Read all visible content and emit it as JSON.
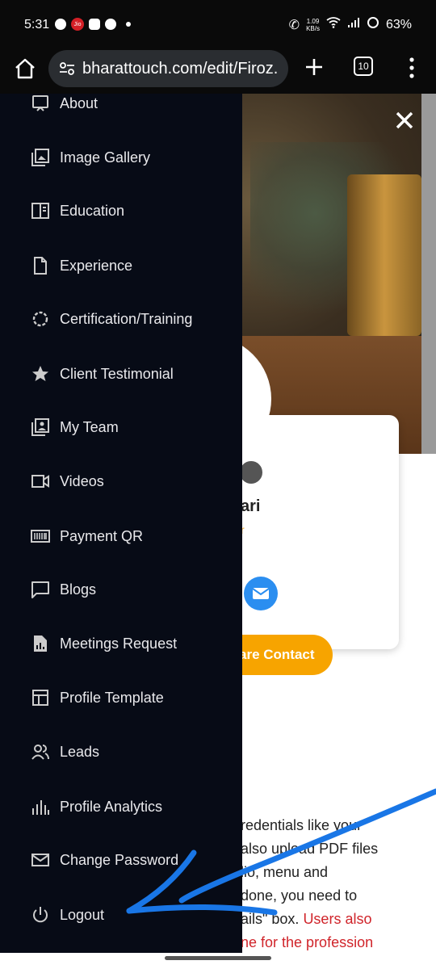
{
  "status_bar": {
    "time": "5:31",
    "jio": "Jio",
    "speed_value": "1.09",
    "speed_unit": "KB/s",
    "battery": "63%"
  },
  "browser": {
    "url": "bharattouch.com/edit/Firoz.",
    "tab_count": "10"
  },
  "drawer": {
    "items": [
      {
        "label": "About",
        "icon": "about-icon"
      },
      {
        "label": "Image Gallery",
        "icon": "image-gallery-icon"
      },
      {
        "label": "Education",
        "icon": "education-icon"
      },
      {
        "label": "Experience",
        "icon": "experience-icon"
      },
      {
        "label": "Certification/Training",
        "icon": "certification-icon"
      },
      {
        "label": "Client Testimonial",
        "icon": "star-icon"
      },
      {
        "label": "My Team",
        "icon": "team-icon"
      },
      {
        "label": "Videos",
        "icon": "video-icon"
      },
      {
        "label": "Payment QR",
        "icon": "barcode-icon"
      },
      {
        "label": "Blogs",
        "icon": "blog-icon"
      },
      {
        "label": "Meetings Request",
        "icon": "meetings-icon"
      },
      {
        "label": "Profile Template",
        "icon": "template-icon"
      },
      {
        "label": "Leads",
        "icon": "leads-icon"
      },
      {
        "label": "Profile Analytics",
        "icon": "analytics-icon"
      },
      {
        "label": "Change Password",
        "icon": "mail-icon"
      },
      {
        "label": "Logout",
        "icon": "power-icon"
      }
    ]
  },
  "page": {
    "name_fragment": "ari",
    "subtitle_fragment": "r",
    "share_button": "are Contact",
    "body_lines": [
      "redentials like your",
      "also upload PDF files",
      "lio, menu and",
      "done, you need to",
      "ails\" box."
    ],
    "body_red_1": "Users also",
    "body_red_2": "ne for the profession"
  },
  "colors": {
    "drawer_bg": "#070b16",
    "accent_orange": "#f7a400",
    "mail_blue": "#2b8ef0",
    "annotation_blue": "#1976e6"
  }
}
